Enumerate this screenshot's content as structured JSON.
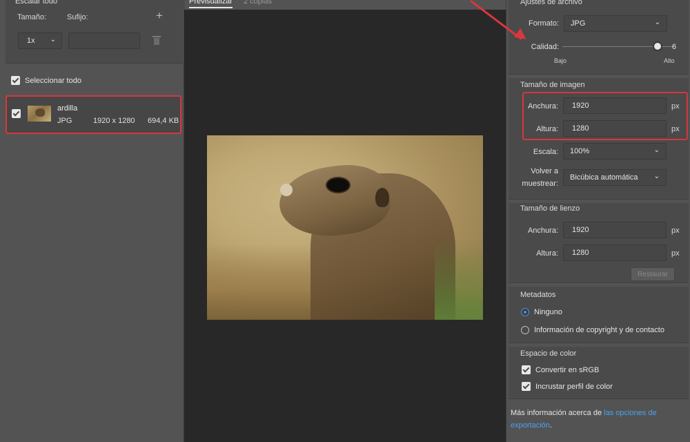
{
  "left": {
    "scale_all_title": "Escalar todo",
    "size_label": "Tamaño:",
    "suffix_label": "Sufijo:",
    "add_icon": "plus-icon",
    "scale_value": "1x",
    "suffix_value": "",
    "select_all_label": "Seleccionar todo",
    "asset": {
      "name": "ardilla",
      "format": "JPG",
      "dimensions": "1920 x 1280",
      "size": "694,4 KB"
    }
  },
  "center": {
    "tabs": [
      {
        "label": "Previsualizar",
        "active": true
      },
      {
        "label": "2 copias",
        "active": false
      }
    ]
  },
  "right": {
    "file_settings_title": "Ajustes de archivo",
    "format_label": "Formato:",
    "format_value": "JPG",
    "quality_label": "Calidad:",
    "quality_value": "6",
    "quality_fraction": 0.85,
    "quality_low": "Bajo",
    "quality_high": "Alto",
    "image_size_title": "Tamaño de imagen",
    "width_label": "Anchura:",
    "width_value": "1920",
    "height_label": "Altura:",
    "height_value": "1280",
    "unit": "px",
    "scale_label": "Escala:",
    "scale_value": "100%",
    "resample_label_1": "Volver a",
    "resample_label_2": "muestrear:",
    "resample_value": "Bicúbica automática",
    "canvas_size_title": "Tamaño de lienzo",
    "canvas_width_value": "1920",
    "canvas_height_value": "1280",
    "restore_label": "Restaurar",
    "metadata_title": "Metadatos",
    "metadata_none": "Ninguno",
    "metadata_copyright": "Información de copyright y de contacto",
    "color_space_title": "Espacio de color",
    "convert_srgb": "Convertir en sRGB",
    "embed_profile": "Incrustar perfil de color",
    "footer_text": "Más información acerca de ",
    "footer_link": "las opciones de exportación",
    "footer_end": "."
  },
  "colors": {
    "highlight": "#d9363e",
    "accent": "#4a90e2",
    "link": "#4aa3f0"
  }
}
